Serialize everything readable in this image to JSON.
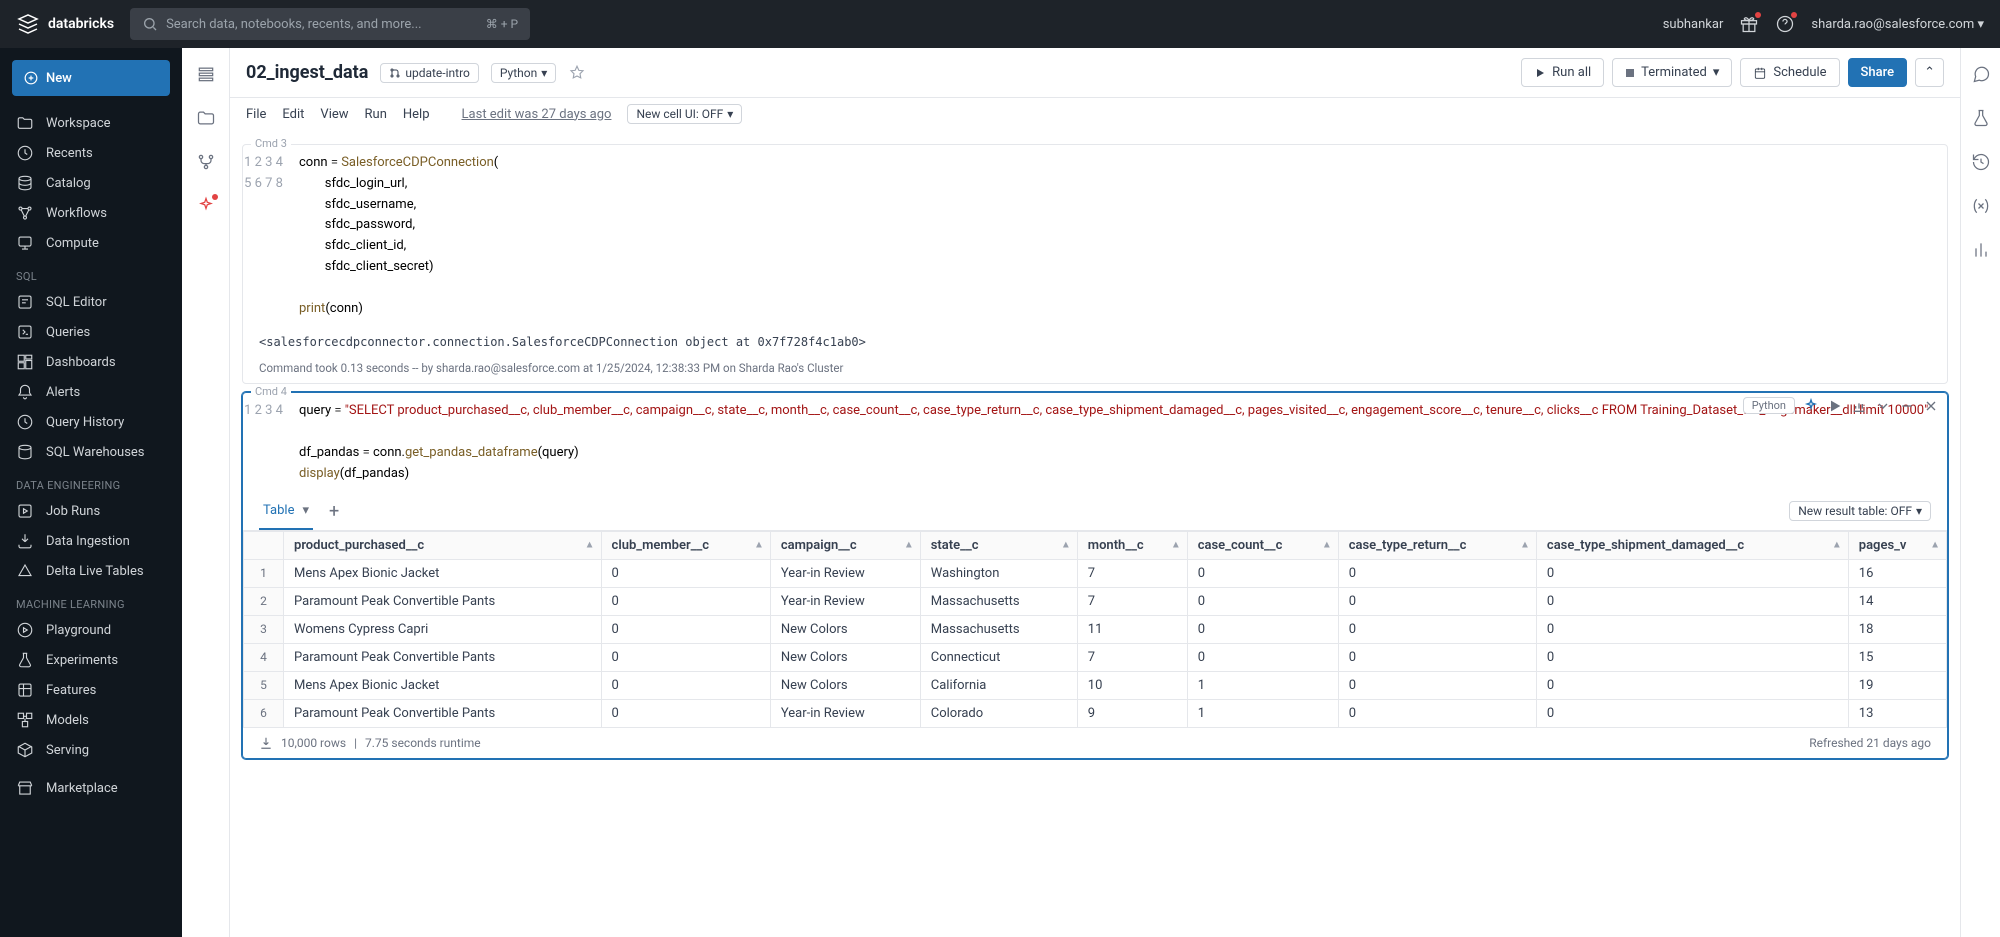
{
  "header": {
    "logo": "databricks",
    "search_placeholder": "Search data, notebooks, recents, and more...",
    "search_shortcut": "⌘ + P",
    "user_label": "subhankar",
    "account_email": "sharda.rao@salesforce.com"
  },
  "left_nav": {
    "new_label": "New",
    "items_main": [
      "Workspace",
      "Recents",
      "Catalog",
      "Workflows",
      "Compute"
    ],
    "section_sql": "SQL",
    "items_sql": [
      "SQL Editor",
      "Queries",
      "Dashboards",
      "Alerts",
      "Query History",
      "SQL Warehouses"
    ],
    "section_de": "Data Engineering",
    "items_de": [
      "Job Runs",
      "Data Ingestion",
      "Delta Live Tables"
    ],
    "section_ml": "Machine Learning",
    "items_ml": [
      "Playground",
      "Experiments",
      "Features",
      "Models",
      "Serving"
    ],
    "marketplace": "Marketplace"
  },
  "doc": {
    "title": "02_ingest_data",
    "branch": "update-intro",
    "language": "Python",
    "menu": [
      "File",
      "Edit",
      "View",
      "Run",
      "Help"
    ],
    "last_edit": "Last edit was 27 days ago",
    "newcell_toggle": "New cell UI: OFF",
    "run_all": "Run all",
    "cluster": "Terminated",
    "schedule": "Schedule",
    "share": "Share"
  },
  "cells": [
    {
      "label": "Cmd 3",
      "lines": [
        {
          "n": "1",
          "html": "conn <span class='op'>=</span> <span class='fn'>SalesforceCDPConnection</span>("
        },
        {
          "n": "2",
          "html": "        sfdc_login_url,"
        },
        {
          "n": "3",
          "html": "        sfdc_username,"
        },
        {
          "n": "4",
          "html": "        sfdc_password,"
        },
        {
          "n": "5",
          "html": "        sfdc_client_id,"
        },
        {
          "n": "6",
          "html": "        sfdc_client_secret)"
        },
        {
          "n": "7",
          "html": ""
        },
        {
          "n": "8",
          "html": "<span class='fn'>print</span>(conn)"
        }
      ],
      "output": "<salesforcecdpconnector.connection.SalesforceCDPConnection object at 0x7f728f4c1ab0>",
      "meta": "Command took 0.13 seconds -- by sharda.rao@salesforce.com at 1/25/2024, 12:38:33 PM on Sharda Rao's Cluster"
    },
    {
      "label": "Cmd 4",
      "lang_tag": "Python",
      "lines": [
        {
          "n": "1",
          "html": "query <span class='op'>=</span> <span class='str'>\"SELECT product_purchased__c, club_member__c, campaign__c, state__c, month__c, case_count__c, case_type_return__c, case_type_shipment_damaged__c, pages_visited__c, engagement_score__c, tenure__c, clicks__c FROM Training_Dataset_for_Sagemaker__dll limit 10000\"</span>"
        },
        {
          "n": "2",
          "html": ""
        },
        {
          "n": "3",
          "html": "df_pandas <span class='op'>=</span> conn.<span class='fn'>get_pandas_dataframe</span>(query)"
        },
        {
          "n": "4",
          "html": "<span class='fn'>display</span>(df_pandas)"
        }
      ]
    }
  ],
  "result": {
    "tab_label": "Table",
    "toggle_label": "New result table: OFF",
    "columns": [
      "product_purchased__c",
      "club_member__c",
      "campaign__c",
      "state__c",
      "month__c",
      "case_count__c",
      "case_type_return__c",
      "case_type_shipment_damaged__c",
      "pages_v"
    ],
    "rows": [
      [
        "Mens Apex Bionic Jacket",
        "0",
        "Year-in Review",
        "Washington",
        "7",
        "0",
        "0",
        "0",
        "16"
      ],
      [
        "Paramount Peak Convertible Pants",
        "0",
        "Year-in Review",
        "Massachusetts",
        "7",
        "0",
        "0",
        "0",
        "14"
      ],
      [
        "Womens Cypress Capri",
        "0",
        "New Colors",
        "Massachusetts",
        "11",
        "0",
        "0",
        "0",
        "18"
      ],
      [
        "Paramount Peak Convertible Pants",
        "0",
        "New Colors",
        "Connecticut",
        "7",
        "0",
        "0",
        "0",
        "15"
      ],
      [
        "Mens Apex Bionic Jacket",
        "0",
        "New Colors",
        "California",
        "10",
        "1",
        "0",
        "0",
        "19"
      ],
      [
        "Paramount Peak Convertible Pants",
        "0",
        "Year-in Review",
        "Colorado",
        "9",
        "1",
        "0",
        "0",
        "13"
      ]
    ],
    "footer_rows": "10,000 rows",
    "footer_runtime": "7.75 seconds runtime",
    "footer_refresh": "Refreshed 21 days ago"
  }
}
